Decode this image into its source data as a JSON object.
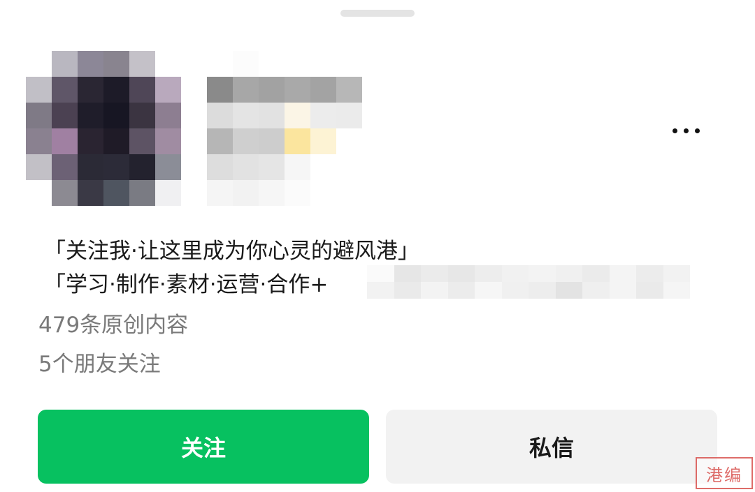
{
  "profile": {
    "avatar_icon": "avatar-mosaic",
    "more_icon": "more-dots-icon",
    "bio_line1": "「关注我·让这里成为你心灵的避风港」",
    "bio_line2_visible": "「学习·制作·素材·运营·合作+",
    "original_count": "479条原创内容",
    "friends_following": "5个朋友关注"
  },
  "actions": {
    "follow_label": "关注",
    "message_label": "私信"
  },
  "watermark": {
    "text": "港编"
  },
  "colors": {
    "follow_green": "#07c160",
    "message_gray": "#f2f2f2",
    "meta_text": "#7a7a7a",
    "watermark_red": "#d9534f"
  }
}
